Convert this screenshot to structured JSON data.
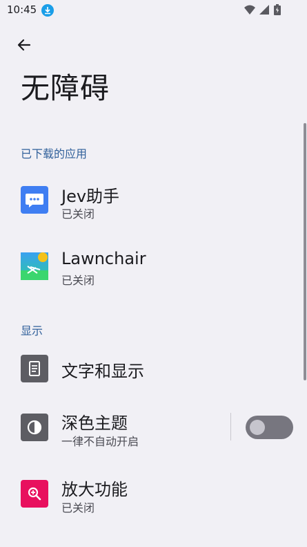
{
  "status_bar": {
    "time": "10:45"
  },
  "header": {
    "title": "无障碍"
  },
  "sections": [
    {
      "header": "已下载的应用",
      "items": [
        {
          "title": "Jev助手",
          "subtitle": "已关闭",
          "icon": "chat-bubble-icon"
        },
        {
          "title": "Lawnchair",
          "subtitle": "已关闭",
          "icon": "lawnchair-icon"
        }
      ]
    },
    {
      "header": "显示",
      "items": [
        {
          "title": "文字和显示",
          "subtitle": "",
          "icon": "text-display-icon"
        },
        {
          "title": "深色主题",
          "subtitle": "一律不自动开启",
          "icon": "dark-theme-icon",
          "toggle": false
        },
        {
          "title": "放大功能",
          "subtitle": "已关闭",
          "icon": "magnify-icon"
        }
      ]
    }
  ],
  "colors": {
    "background": "#f1f0f5",
    "section_header": "#2f5f9a",
    "jev_icon": "#3f7ef2",
    "magnify_icon": "#e8105e",
    "display_icon": "#5d5d63"
  }
}
